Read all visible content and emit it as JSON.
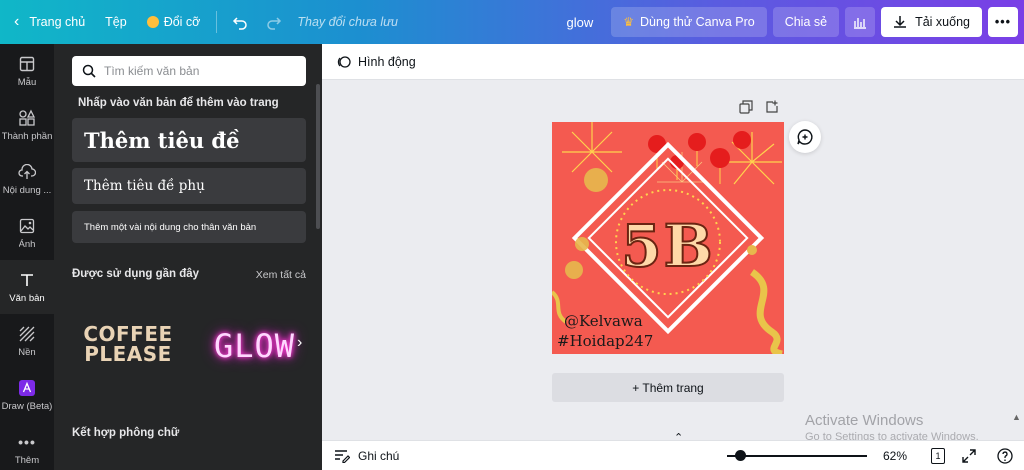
{
  "topbar": {
    "home_label": "Trang chủ",
    "file_label": "Tệp",
    "resize_label": "Đổi cỡ",
    "status_text": "Thay đổi chưa lưu",
    "doc_title": "glow",
    "try_pro_label": "Dùng thử Canva Pro",
    "share_label": "Chia sẻ",
    "download_label": "Tải xuống",
    "gradient_colors": [
      "#10b7c8",
      "#7a3fe6"
    ]
  },
  "rail": {
    "items": [
      {
        "label": "Mẫu",
        "icon": "template-icon"
      },
      {
        "label": "Thành phần",
        "icon": "elements-icon"
      },
      {
        "label": "Nội dung ...",
        "icon": "upload-icon"
      },
      {
        "label": "Ảnh",
        "icon": "photo-icon"
      },
      {
        "label": "Văn bản",
        "icon": "text-icon"
      },
      {
        "label": "Nền",
        "icon": "background-icon"
      },
      {
        "label": "Draw (Beta)",
        "icon": "draw-icon"
      },
      {
        "label": "Thêm",
        "icon": "more-icon"
      }
    ]
  },
  "panel": {
    "search_placeholder": "Tìm kiếm văn bản",
    "hint": "Nhấp vào văn bản để thêm vào trang",
    "heading": "Thêm tiêu đề",
    "subheading": "Thêm tiêu đề phụ",
    "body": "Thêm một vài nội dung cho thân văn bản",
    "recent_title": "Được sử dụng gần đây",
    "see_all": "Xem tất cả",
    "recent_items": [
      "COFFEE PLEASE",
      "GLOW"
    ],
    "combos_title": "Kết hợp phông chữ"
  },
  "canvas": {
    "animate_label": "Hình động",
    "design_big_text": "5B",
    "design_line1": "@Kelvawa",
    "design_line2": "#Hoidap247",
    "add_page_label": "+ Thêm trang",
    "watermark_title": "Activate Windows",
    "watermark_sub": "Go to Settings to activate Windows.",
    "background_color": "#f45a50"
  },
  "bottombar": {
    "notes_label": "Ghi chú",
    "zoom_label": "62%",
    "page_count": "1"
  }
}
